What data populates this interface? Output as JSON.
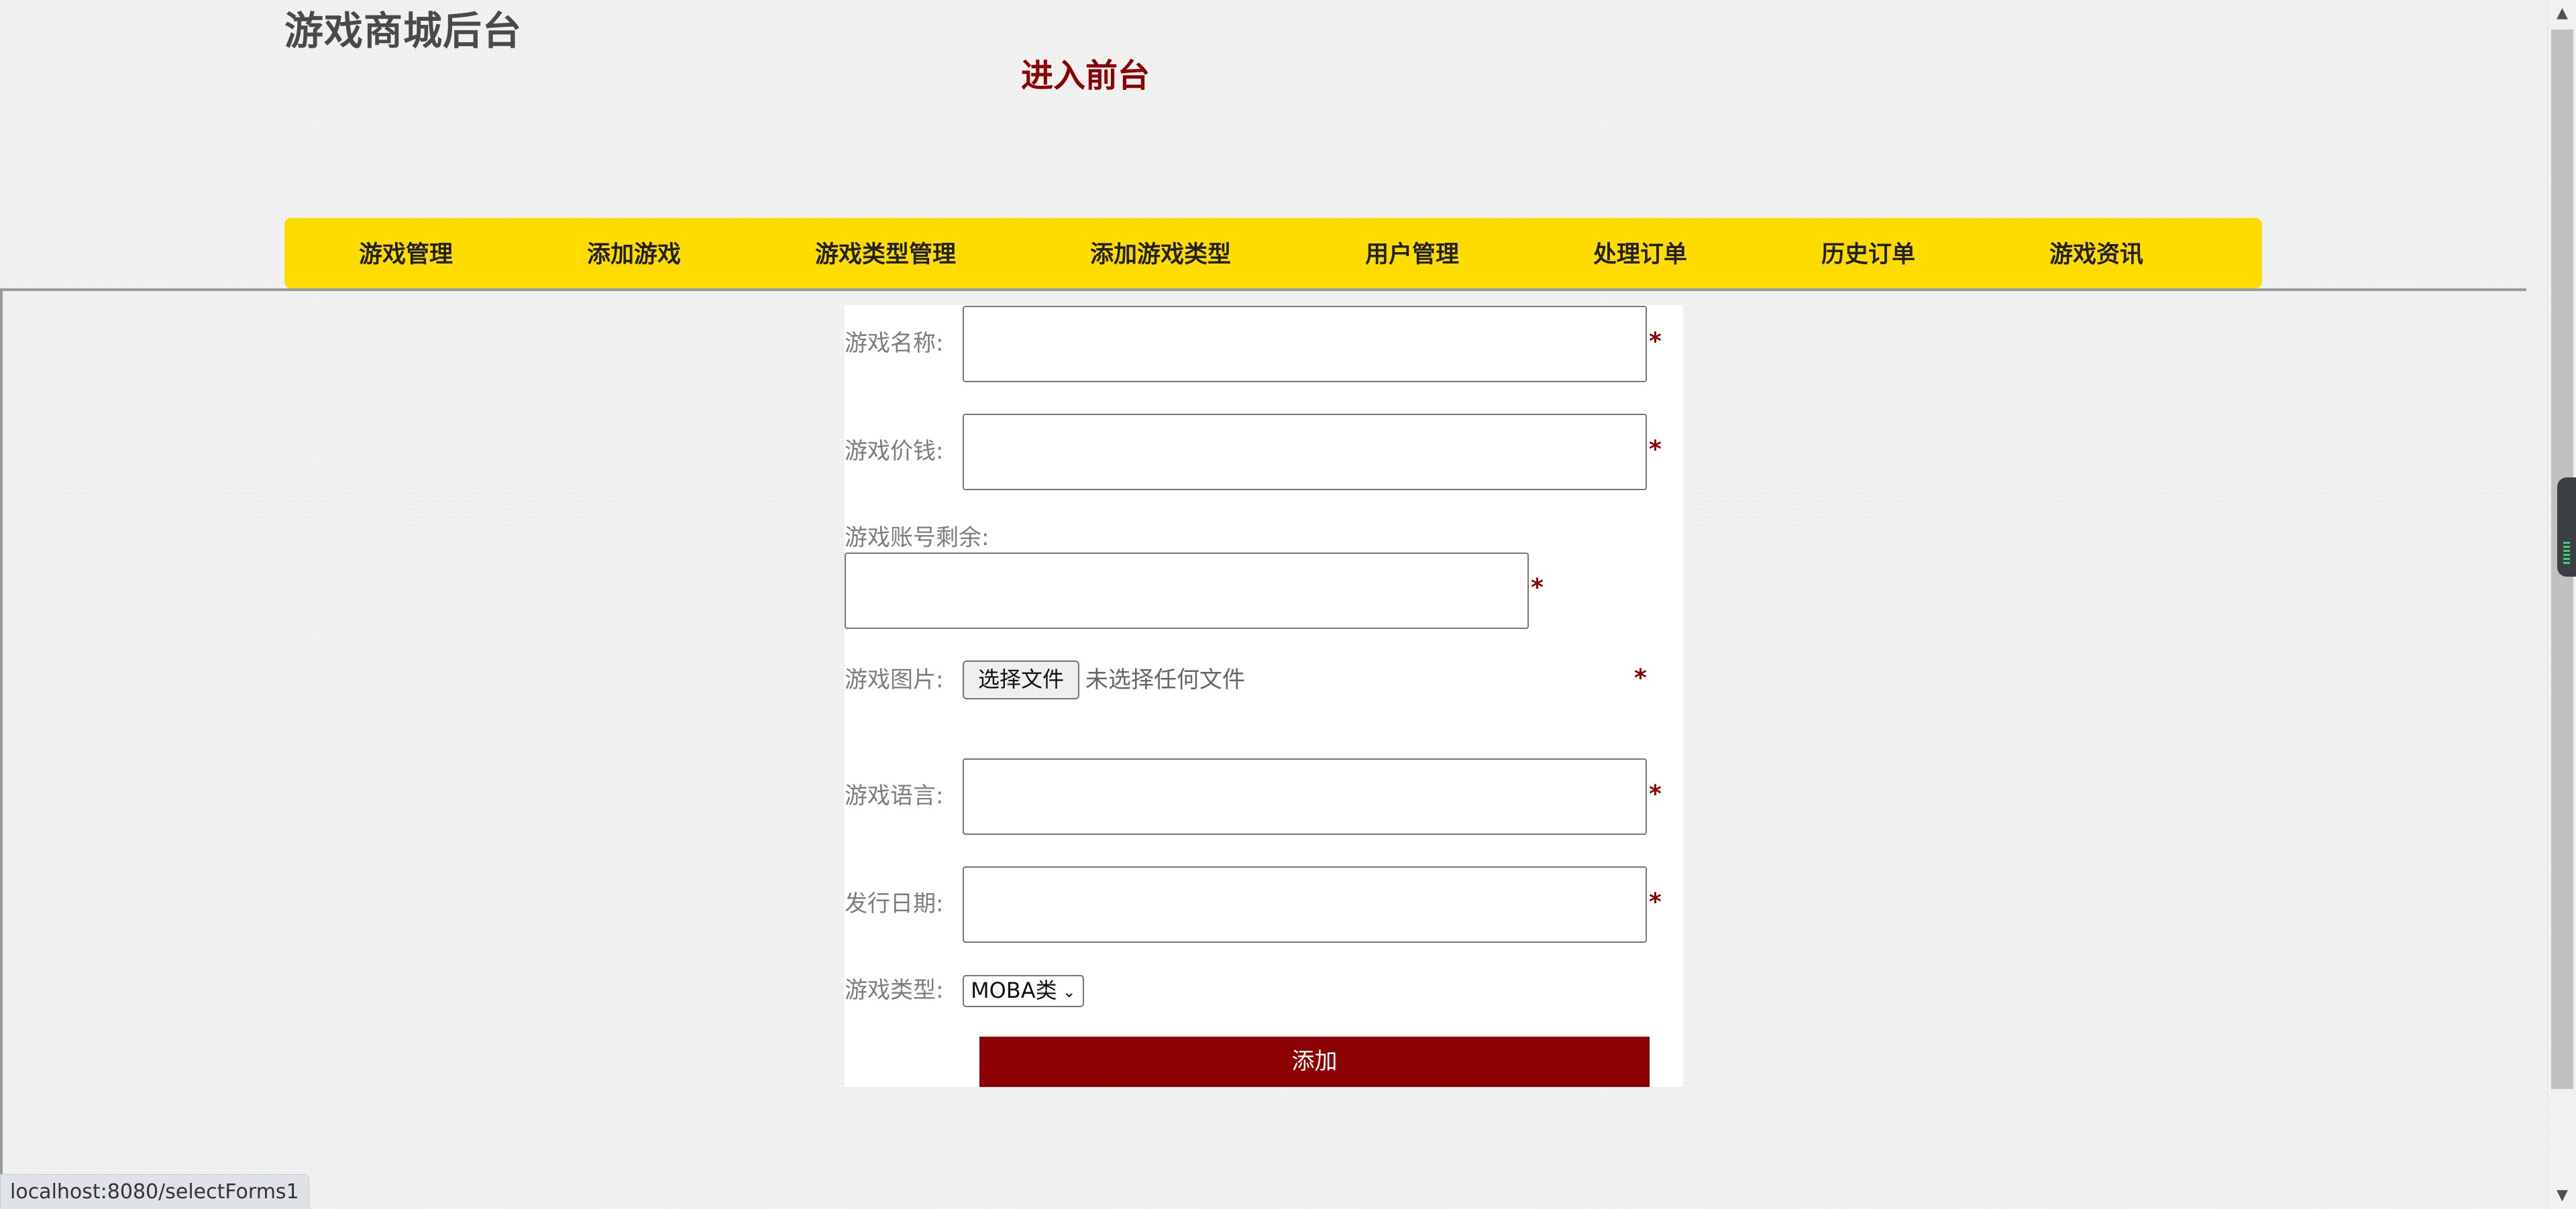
{
  "header": {
    "site_title": "游戏商城后台",
    "front_link": "进入前台"
  },
  "nav": {
    "items": [
      {
        "label": "游戏管理"
      },
      {
        "label": "添加游戏"
      },
      {
        "label": "游戏类型管理"
      },
      {
        "label": "添加游戏类型"
      },
      {
        "label": "用户管理"
      },
      {
        "label": "处理订单"
      },
      {
        "label": "历史订单"
      },
      {
        "label": "游戏资讯"
      }
    ]
  },
  "form": {
    "name_label": "游戏名称:",
    "name_value": "",
    "price_label": "游戏价钱:",
    "price_value": "",
    "stock_label": "游戏账号剩余:",
    "stock_value": "",
    "image_label": "游戏图片:",
    "file_button": "选择文件",
    "file_status": "未选择任何文件",
    "language_label": "游戏语言:",
    "language_value": "",
    "date_label": "发行日期:",
    "date_value": "",
    "type_label": "游戏类型:",
    "type_selected": "MOBA类",
    "required_mark": "*",
    "submit_label": "添加"
  },
  "status_bar": {
    "url": "localhost:8080/selectForms1"
  },
  "icons": {
    "scroll_up": "triangle-up-icon",
    "scroll_down": "triangle-down-icon",
    "select_chevron": "chevron-down-icon"
  },
  "colors": {
    "accent_dark_red": "#8b0000",
    "nav_yellow": "#ffdc00",
    "title_gray": "#4a4a4a"
  }
}
